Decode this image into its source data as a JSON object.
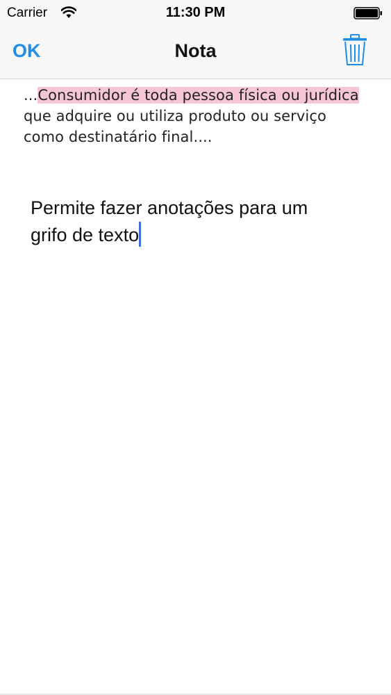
{
  "status_bar": {
    "carrier": "Carrier",
    "time": "11:30 PM"
  },
  "nav": {
    "ok_label": "OK",
    "title": "Nota",
    "trash_icon": "trash-icon"
  },
  "excerpt": {
    "prefix": "...",
    "highlighted": "Consumidor é toda pessoa física ou jurídica",
    "rest_line2": "que adquire ou utiliza produto ou serviço",
    "rest_line3": "como destinatário final...."
  },
  "note": {
    "text_line1": "Permite fazer anotações para um",
    "text_line2": "grifo de texto"
  },
  "colors": {
    "accent": "#1f8ce6",
    "highlight": "#f6c6d7",
    "caret": "#3b6fe0"
  }
}
